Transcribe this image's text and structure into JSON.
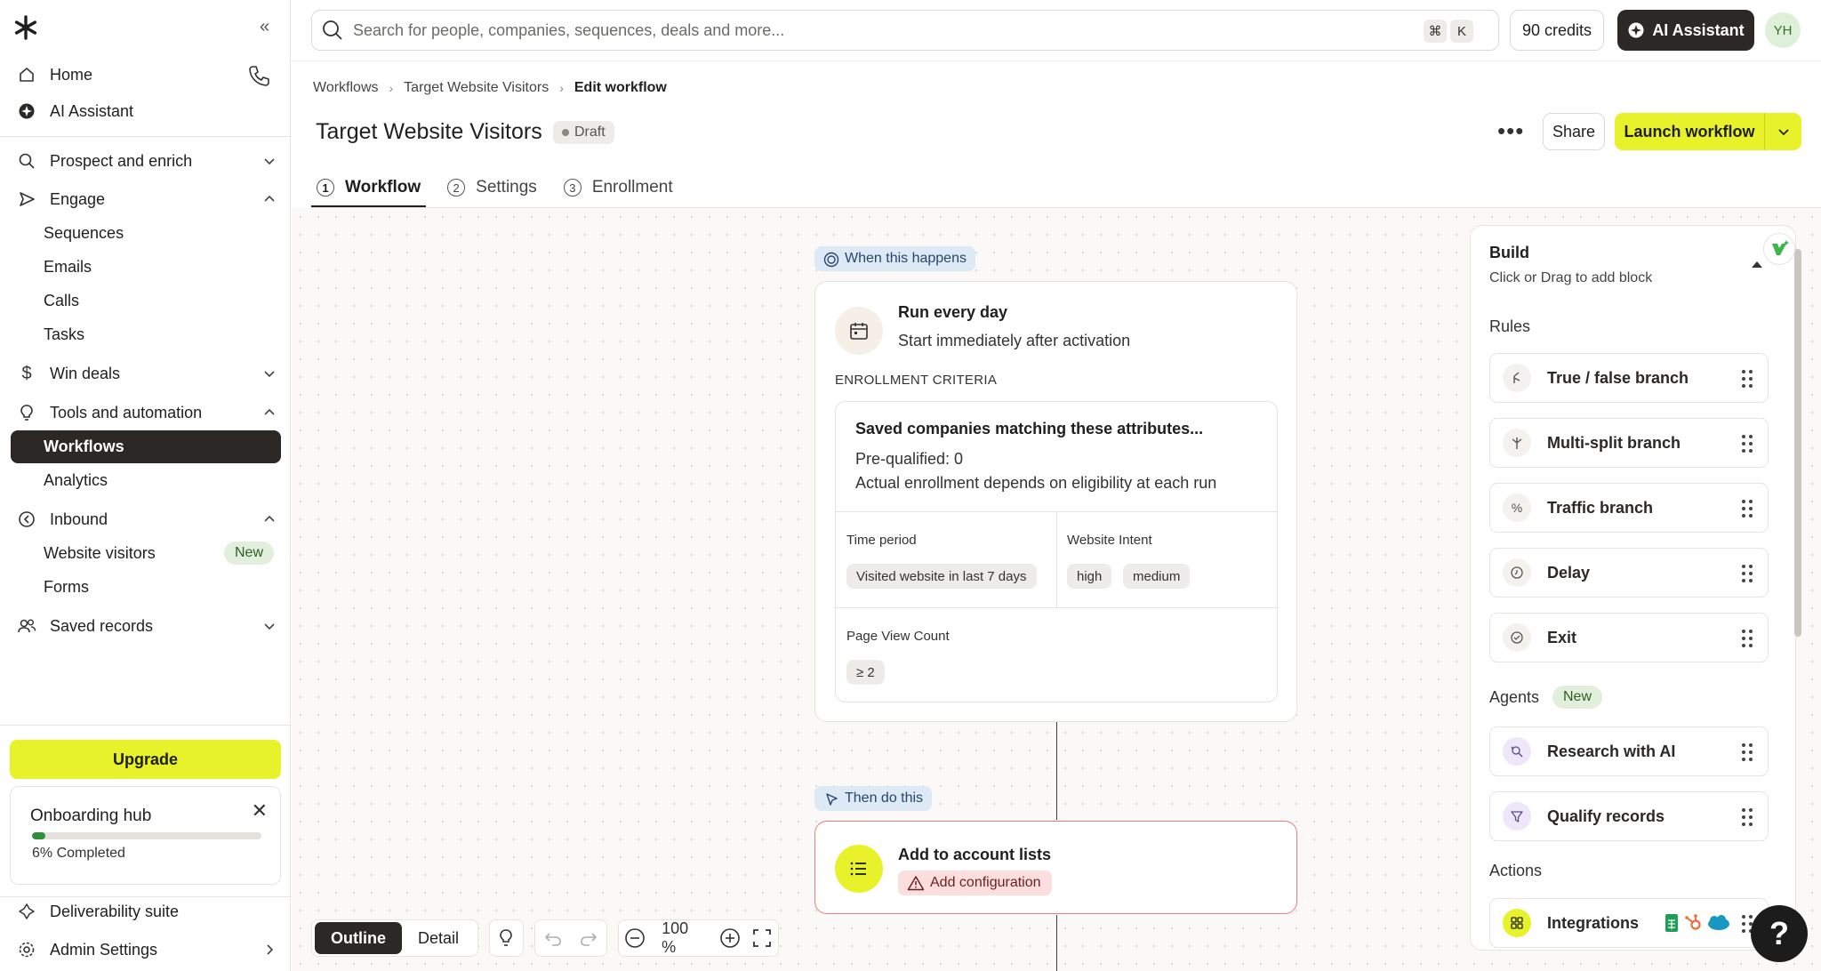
{
  "sidebar": {
    "nav": {
      "home": "Home",
      "ai_assistant": "AI Assistant",
      "prospect": "Prospect and enrich",
      "engage": "Engage",
      "sequences": "Sequences",
      "emails": "Emails",
      "calls": "Calls",
      "tasks": "Tasks",
      "win_deals": "Win deals",
      "tools": "Tools and automation",
      "workflows": "Workflows",
      "analytics": "Analytics",
      "inbound": "Inbound",
      "website_visitors": "Website visitors",
      "website_visitors_badge": "New",
      "forms": "Forms",
      "saved_records": "Saved records"
    },
    "upgrade": "Upgrade",
    "onboarding": {
      "title": "Onboarding hub",
      "progress_text": "6% Completed",
      "progress": 0.06
    },
    "deliverability": "Deliverability suite",
    "admin": "Admin Settings"
  },
  "topbar": {
    "search_placeholder": "Search for people, companies, sequences, deals and more...",
    "shortcut_1": "⌘",
    "shortcut_2": "K",
    "credits": "90 credits",
    "ai_button": "AI Assistant",
    "avatar": "YH"
  },
  "header": {
    "breadcrumb": [
      "Workflows",
      "Target Website Visitors",
      "Edit workflow"
    ],
    "title": "Target Website Visitors",
    "status": "Draft",
    "share": "Share",
    "launch": "Launch workflow",
    "tabs": [
      {
        "num": "1",
        "label": "Workflow"
      },
      {
        "num": "2",
        "label": "Settings"
      },
      {
        "num": "3",
        "label": "Enrollment"
      }
    ]
  },
  "canvas": {
    "when_pill": "When this happens",
    "trigger": {
      "title": "Run every day",
      "subtitle": "Start immediately after activation",
      "criteria_label": "ENROLLMENT CRITERIA",
      "criteria_heading": "Saved companies matching these attributes...",
      "prequalified": "Pre-qualified: 0",
      "note": "Actual enrollment depends on eligibility at each run",
      "time_period_label": "Time period",
      "time_period_value": "Visited website in last 7 days",
      "intent_label": "Website Intent",
      "intent_values": [
        "high",
        "medium"
      ],
      "pageview_label": "Page View Count",
      "pageview_value": "≥ 2"
    },
    "then_pill": "Then do this",
    "action": {
      "title": "Add to account lists",
      "warning": "Add configuration"
    }
  },
  "toolbar": {
    "outline": "Outline",
    "detail": "Detail",
    "zoom": "100",
    "zoom_unit": "%"
  },
  "build": {
    "title": "Build",
    "subtitle": "Click or Drag to add block",
    "rules_heading": "Rules",
    "rules": [
      "True / false branch",
      "Multi-split branch",
      "Traffic branch",
      "Delay",
      "Exit"
    ],
    "agents_heading": "Agents",
    "agents_badge": "New",
    "agents": [
      "Research with AI",
      "Qualify records"
    ],
    "actions_heading": "Actions",
    "actions": [
      "Integrations"
    ]
  },
  "colors": {
    "accent": "#e8f22a",
    "dark": "#2b2826",
    "warning_border": "#f07b7b"
  }
}
